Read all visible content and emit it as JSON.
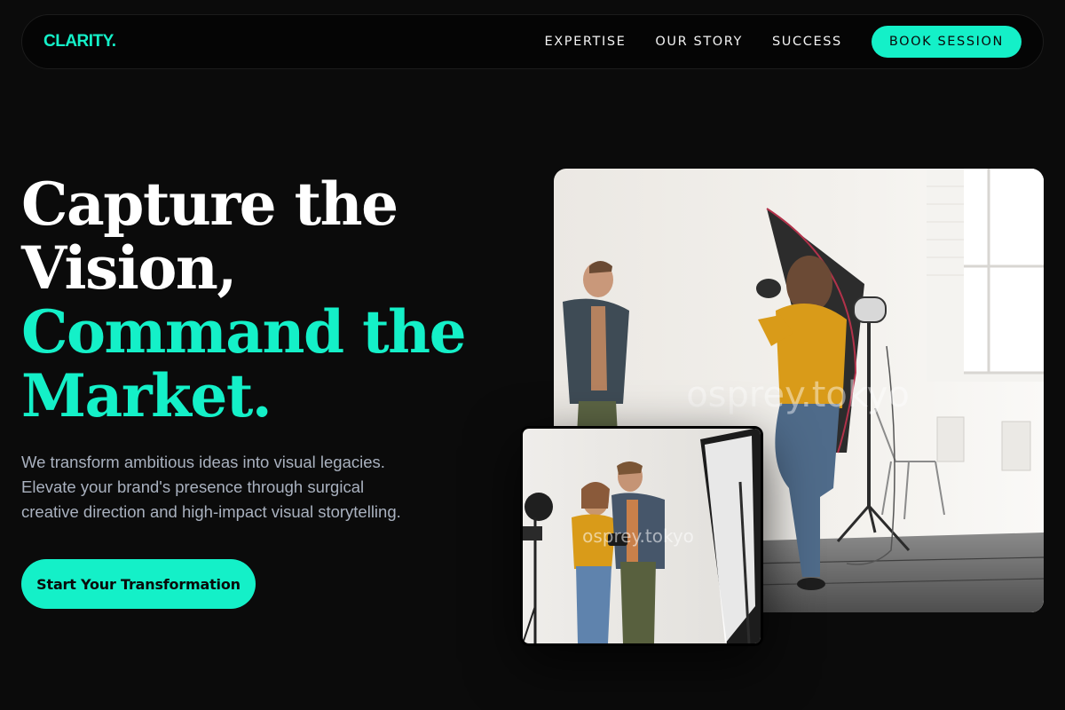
{
  "nav": {
    "brand": "CLARITY.",
    "links": [
      "EXPERTISE",
      "OUR STORY",
      "SUCCESS"
    ],
    "cta": "BOOK SESSION"
  },
  "hero": {
    "title_lines": [
      "Capture the",
      "Vision,"
    ],
    "accent_lines": [
      "Command the",
      "Market."
    ],
    "description_lines": [
      "We transform ambitious ideas into visual legacies.",
      "Elevate your brand's presence through surgical",
      "creative direction and high-impact visual storytelling."
    ],
    "cta": "Start Your Transformation"
  },
  "images": {
    "main_watermark": "osprey.tokyo",
    "inset_watermark": "osprey.tokyo"
  },
  "colors": {
    "accent": "#14f0c8",
    "background": "#0b0b0b",
    "text_muted": "#a9b1bf"
  }
}
